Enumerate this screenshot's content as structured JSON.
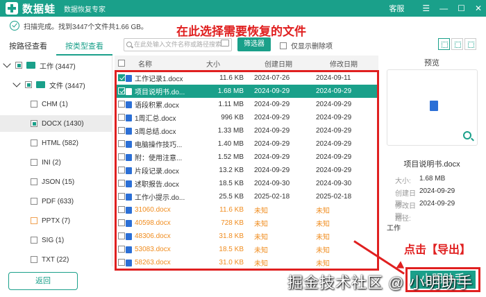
{
  "titlebar": {
    "app_name": "数据蛙",
    "subtitle": "数据恢复专家",
    "service": "客服",
    "menu": "☰",
    "minimize": "—",
    "maximize": "☐",
    "close": "✕"
  },
  "status": {
    "scan_complete": "扫描完成。找到3447个文件共1.66 GB。"
  },
  "annotations": {
    "top": "在此选择需要恢复的文件",
    "export_hint": "点击【导出】"
  },
  "watermark": "掘金技术社区 @ 小明助手",
  "sidebar": {
    "tabs": [
      "按路径查看",
      "按类型查看"
    ],
    "items": [
      {
        "label": "工作 (3447)"
      },
      {
        "label": "文件 (3447)"
      },
      {
        "label": "CHM (1)"
      },
      {
        "label": "DOCX (1430)"
      },
      {
        "label": "HTML (582)"
      },
      {
        "label": "INI (2)"
      },
      {
        "label": "JSON (15)"
      },
      {
        "label": "PDF (633)"
      },
      {
        "label": "PPTX (7)"
      },
      {
        "label": "SIG (1)"
      },
      {
        "label": "TXT (22)"
      }
    ]
  },
  "toolbar": {
    "search_placeholder": "在此处输入文件名称或路径搜索",
    "filter_label": "筛选器",
    "only_deleted": "仅显示删除项"
  },
  "table": {
    "columns": [
      "名称",
      "大小",
      "创建日期",
      "修改日期"
    ],
    "rows": [
      {
        "name": "工作记录1.docx",
        "size": "11.6 KB",
        "created": "2024-07-26",
        "modified": "2024-09-11"
      },
      {
        "name": "项目说明书.do...",
        "size": "1.68 MB",
        "created": "2024-09-29",
        "modified": "2024-09-29"
      },
      {
        "name": "语段积累.docx",
        "size": "1.11 MB",
        "created": "2024-09-29",
        "modified": "2024-09-29"
      },
      {
        "name": "1周汇总.docx",
        "size": "996 KB",
        "created": "2024-09-29",
        "modified": "2024-09-29"
      },
      {
        "name": "3周总结.docx",
        "size": "1.33 MB",
        "created": "2024-09-29",
        "modified": "2024-09-29"
      },
      {
        "name": "电脑操作技巧...",
        "size": "1.40 MB",
        "created": "2024-09-29",
        "modified": "2024-09-29"
      },
      {
        "name": "附：使用注意...",
        "size": "1.52 MB",
        "created": "2024-09-29",
        "modified": "2024-09-29"
      },
      {
        "name": "片段记录.docx",
        "size": "13.2 KB",
        "created": "2024-09-29",
        "modified": "2024-09-29"
      },
      {
        "name": "述职报告.docx",
        "size": "18.5 KB",
        "created": "2024-09-30",
        "modified": "2024-09-30"
      },
      {
        "name": "工作小提示.do...",
        "size": "25.5 KB",
        "created": "2025-02-18",
        "modified": "2025-02-18"
      },
      {
        "name": "31060.docx",
        "size": "11.6 KB",
        "created": "未知",
        "modified": "未知"
      },
      {
        "name": "40598.docx",
        "size": "728 KB",
        "created": "未知",
        "modified": "未知"
      },
      {
        "name": "48306.docx",
        "size": "31.8 KB",
        "created": "未知",
        "modified": "未知"
      },
      {
        "name": "53083.docx",
        "size": "18.5 KB",
        "created": "未知",
        "modified": "未知"
      },
      {
        "name": "58263.docx",
        "size": "31.0 KB",
        "created": "未知",
        "modified": "未知"
      }
    ]
  },
  "preview": {
    "title": "预览",
    "file_name": "项目说明书.docx",
    "size_label": "大小:",
    "size_value": "1.68 MB",
    "created_label": "创建日期:",
    "created_value": "2024-09-29",
    "modified_label": "修改日期:",
    "modified_value": "2024-09-29",
    "path_label": "路径:",
    "path_value": "工作"
  },
  "buttons": {
    "back": "返回",
    "export": "小明助手"
  },
  "colors": {
    "accent": "#1aa08a",
    "annotation_red": "#e02020",
    "orange_text": "#f08c1e"
  }
}
